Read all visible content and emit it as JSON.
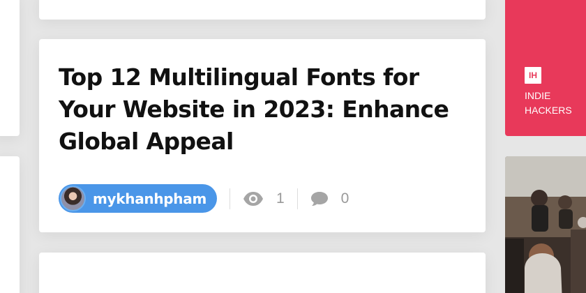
{
  "article": {
    "title": "Top 12 Multilingual Fonts for Your Website in 2023: Enhance Global Appeal",
    "author": "mykhanhpham",
    "views": "1",
    "comments": "0"
  },
  "sidebar_ad": {
    "logo_text": "IH",
    "text": "INDIE HACKERS",
    "accent_color": "#e8395a"
  },
  "icons": {
    "views": "eye-icon",
    "comments": "comment-icon"
  }
}
